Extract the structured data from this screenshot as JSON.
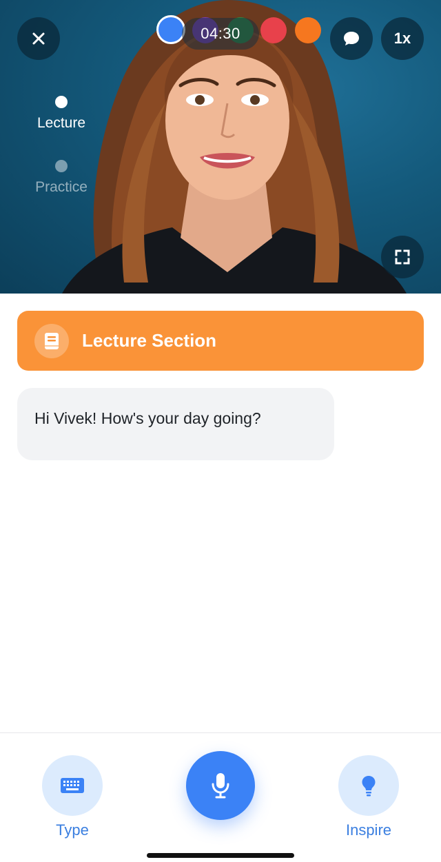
{
  "video": {
    "timer": "04:30",
    "speed_label": "1x",
    "progress_dots": [
      {
        "name": "blue",
        "color": "#3b82f6"
      },
      {
        "name": "purple",
        "color": "#7e3fb8"
      },
      {
        "name": "green",
        "color": "#2e8b42"
      },
      {
        "name": "red",
        "color": "#e8414b"
      },
      {
        "name": "orange",
        "color": "#f6771f"
      }
    ],
    "steps": [
      {
        "label": "Lecture",
        "active": true
      },
      {
        "label": "Practice",
        "active": false
      }
    ],
    "icons": {
      "close": "close-icon",
      "chat": "chat-bubble-icon",
      "fullscreen": "fullscreen-icon"
    }
  },
  "section": {
    "title": "Lecture Section",
    "icon": "book-icon",
    "color": "#fa9338"
  },
  "messages": [
    {
      "text": "Hi Vivek! How's your day going?",
      "icon": "translate-icon"
    }
  ],
  "bottom_bar": {
    "type_label": "Type",
    "inspire_label": "Inspire",
    "icons": {
      "type": "keyboard-icon",
      "mic": "microphone-icon",
      "inspire": "lightbulb-icon"
    },
    "accent": "#3b82f6"
  }
}
